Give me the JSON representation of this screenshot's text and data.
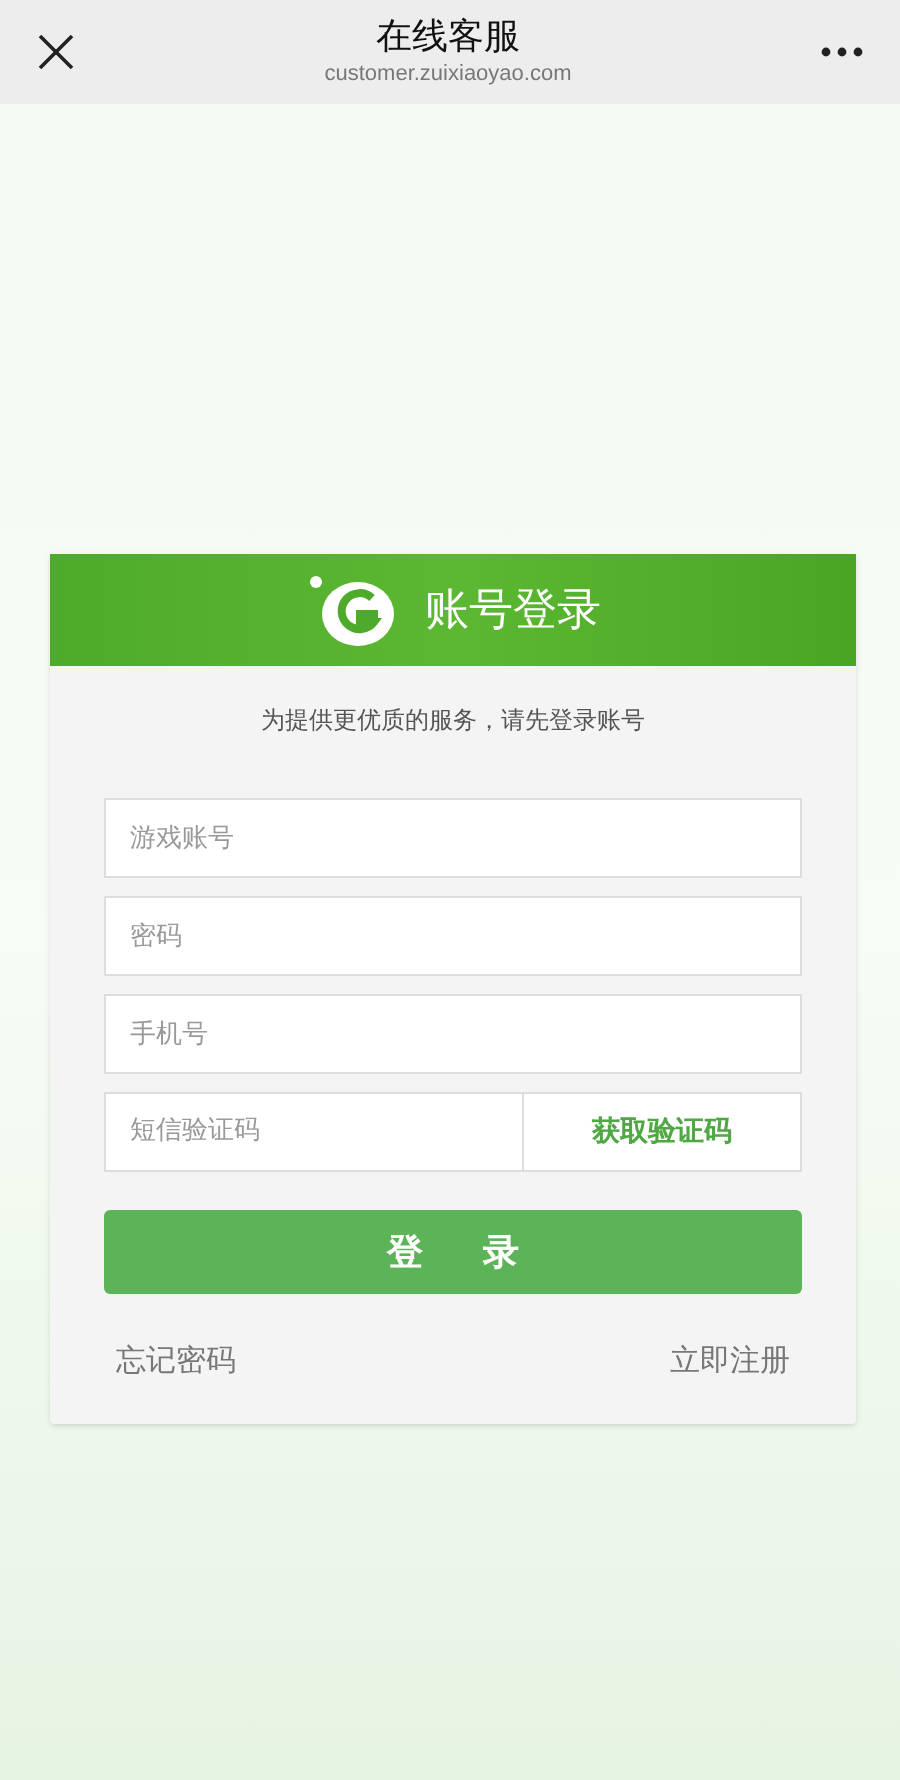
{
  "nav_bar": {
    "title": "在线客服",
    "subtitle": "customer.zuixiaoyao.com"
  },
  "login_card": {
    "title": "账号登录",
    "notice": "为提供更优质的服务，请先登录账号",
    "fields": [
      {
        "placeholder": "游戏账号"
      },
      {
        "placeholder": "密码"
      },
      {
        "placeholder": "手机号"
      }
    ],
    "sms_field": {
      "placeholder": "短信验证码",
      "action": "获取验证码"
    },
    "submit": "登 录",
    "links": [
      "忘记密码",
      "立即注册"
    ]
  }
}
